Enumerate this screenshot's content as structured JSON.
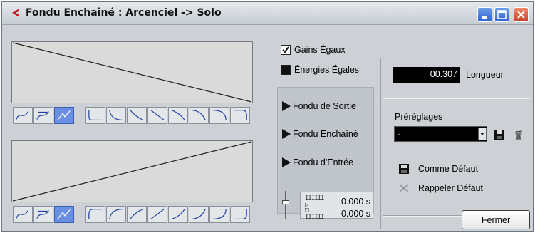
{
  "window": {
    "title": "Fondu Enchaîné : Arcenciel -> Solo",
    "controls": [
      "minimize-icon",
      "maximize-icon",
      "close-icon"
    ]
  },
  "fade_out_editor": {
    "curve_type_buttons": [
      {
        "icon": "spline-curve-icon",
        "active": false
      },
      {
        "icon": "damped-spline-curve-icon",
        "active": false
      },
      {
        "icon": "linear-curve-icon",
        "active": true
      }
    ],
    "preset_shape_count": 8
  },
  "fade_in_editor": {
    "curve_type_buttons": [
      {
        "icon": "spline-curve-icon",
        "active": false
      },
      {
        "icon": "damped-spline-curve-icon",
        "active": false
      },
      {
        "icon": "linear-curve-icon",
        "active": true
      }
    ],
    "preset_shape_count": 8
  },
  "options": {
    "equal_gain": {
      "label": "Gains Égaux",
      "checked": true
    },
    "equal_power": {
      "label": "Énergies Égales",
      "checked": false
    }
  },
  "playback": {
    "fade_out_label": "Fondu de Sortie",
    "crossfade_label": "Fondu Enchaîné",
    "fade_in_label": "Fondu d'Entrée"
  },
  "offsets": {
    "pre_roll_icon": "IIIIII ▷",
    "pre_roll_value": "0.000 s",
    "post_roll_icon": "□ IIIIII",
    "post_roll_value": "0.000 s"
  },
  "length": {
    "value": "00.307",
    "label": "Longueur"
  },
  "presets": {
    "label": "Préréglages",
    "selected": "-",
    "save_icon": "floppy-disk-icon",
    "delete_icon": "trash-icon"
  },
  "defaults": {
    "store_label": "Comme Défaut",
    "recall_label": "Rappeler Défaut"
  },
  "close_button": "Fermer",
  "colors": {
    "window_bg": "#cdd1d6",
    "title_gradient_top": "#e6e9ec",
    "active_button": "#6a8fe2",
    "logo_red": "#c8182a",
    "display_bg": "#000000",
    "display_text": "#ffffff"
  }
}
